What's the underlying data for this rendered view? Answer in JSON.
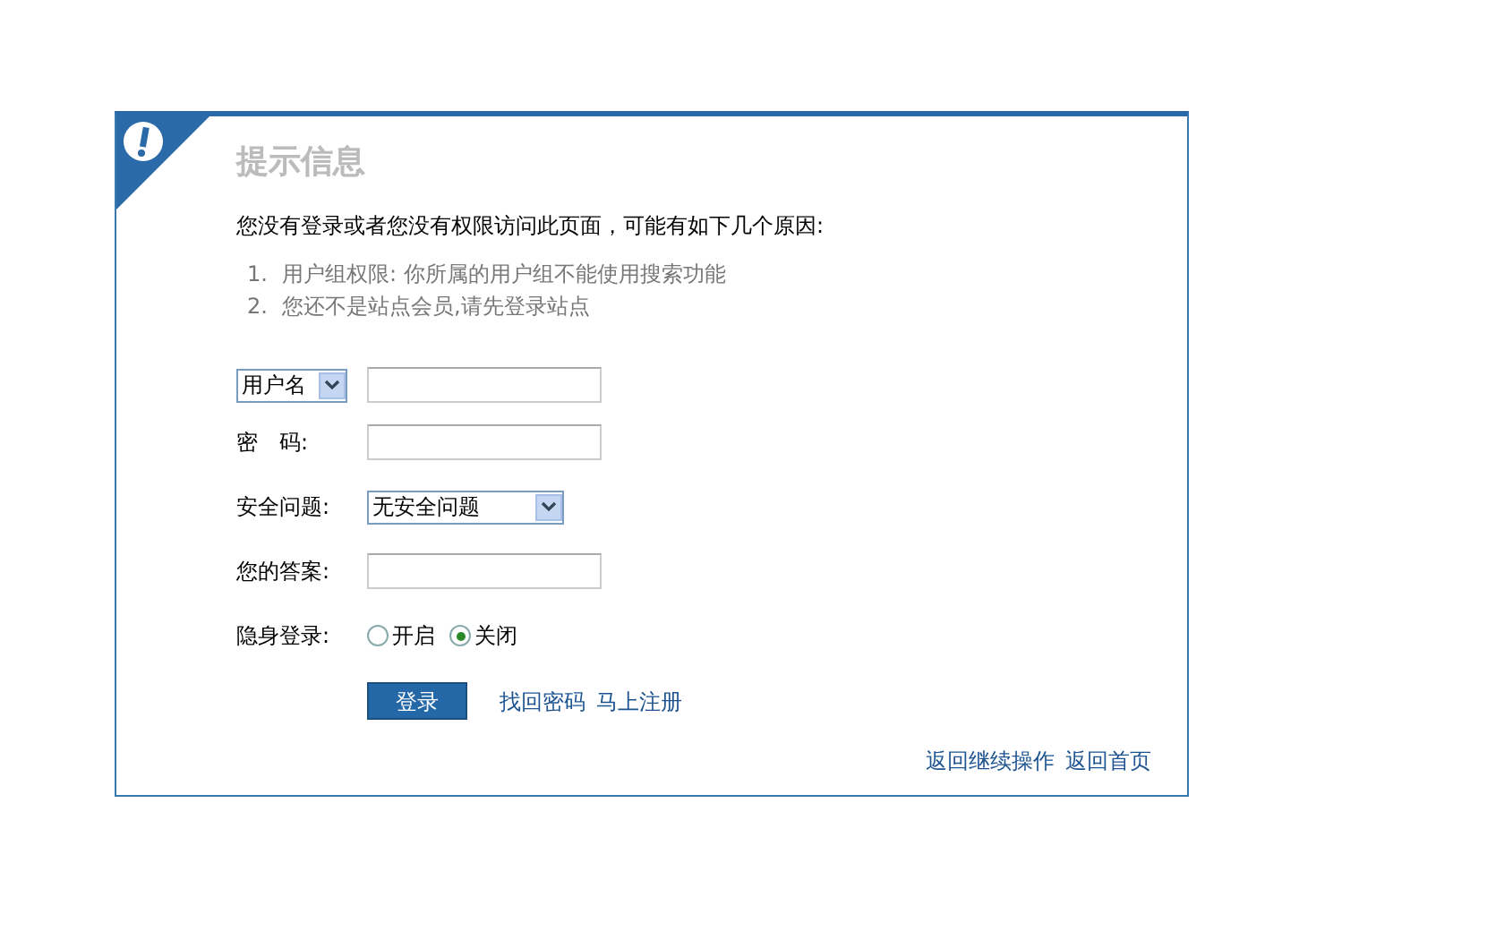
{
  "title": "提示信息",
  "message": "您没有登录或者您没有权限访问此页面，可能有如下几个原因:",
  "reasons": [
    {
      "number": "1.",
      "text": "用户组权限: 你所属的用户组不能使用搜索功能"
    },
    {
      "number": "2.",
      "text": "您还不是站点会员,请先登录站点"
    }
  ],
  "fields": [
    {
      "kind": "select-label",
      "select_value": "用户名"
    },
    {
      "kind": "text",
      "label": "密　码:"
    },
    {
      "kind": "select",
      "label": "安全问题:",
      "value": "无安全问题"
    },
    {
      "kind": "text",
      "label": "您的答案:"
    },
    {
      "kind": "radio",
      "label": "隐身登录:",
      "options": [
        {
          "label": "开启",
          "selected": false
        },
        {
          "label": "关闭",
          "selected": true
        }
      ]
    }
  ],
  "submit": "登录",
  "links": [
    "找回密码",
    "马上注册"
  ],
  "footer_links": [
    "返回继续操作",
    "返回首页"
  ]
}
